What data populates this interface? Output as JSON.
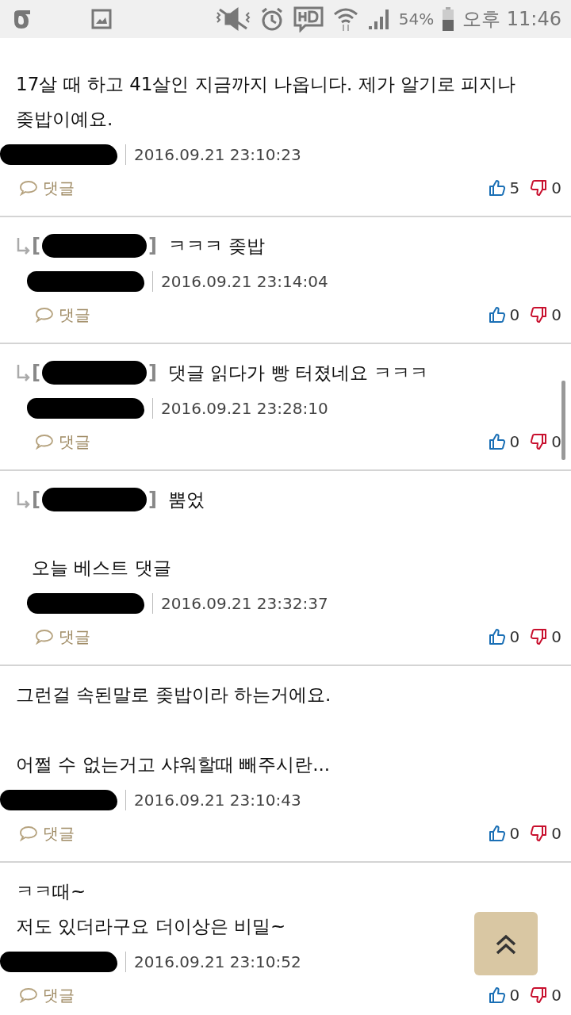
{
  "status_bar": {
    "battery": "54%",
    "time": "오후 11:46"
  },
  "comments": [
    {
      "reply": false,
      "body": "17살 때 하고 41살인 지금까지 나옵니다. 제가 알기로 피지나\n좆밥이예요.",
      "date": "2016.09.21 23:10:23",
      "reply_link": "댓글",
      "likes": "5",
      "dislikes": "0"
    },
    {
      "reply": true,
      "open": "[",
      "close": "]",
      "text": "ㅋㅋㅋ 좆밥",
      "date": "2016.09.21 23:14:04",
      "reply_link": "댓글",
      "likes": "0",
      "dislikes": "0"
    },
    {
      "reply": true,
      "open": "[",
      "close": "]",
      "text": "댓글 읽다가 빵 터졌네요 ㅋㅋㅋ",
      "date": "2016.09.21 23:28:10",
      "reply_link": "댓글",
      "likes": "0",
      "dislikes": "0"
    },
    {
      "reply": true,
      "open": "[",
      "close": "]",
      "text": "뿜었",
      "body": "오늘 베스트 댓글",
      "date": "2016.09.21 23:32:37",
      "reply_link": "댓글",
      "likes": "0",
      "dislikes": "0"
    },
    {
      "reply": false,
      "body": "그런걸 속된말로 좆밥이라 하는거에요.\n\n어쩔 수 없는거고 샤워할때 빼주시란...",
      "date": "2016.09.21 23:10:43",
      "reply_link": "댓글",
      "likes": "0",
      "dislikes": "0"
    },
    {
      "reply": false,
      "body": "ㅋㅋ때~\n저도 있더라구요 더이상은 비밀~",
      "date": "2016.09.21 23:10:52",
      "reply_link": "댓글",
      "likes": "0",
      "dislikes": "0"
    }
  ]
}
